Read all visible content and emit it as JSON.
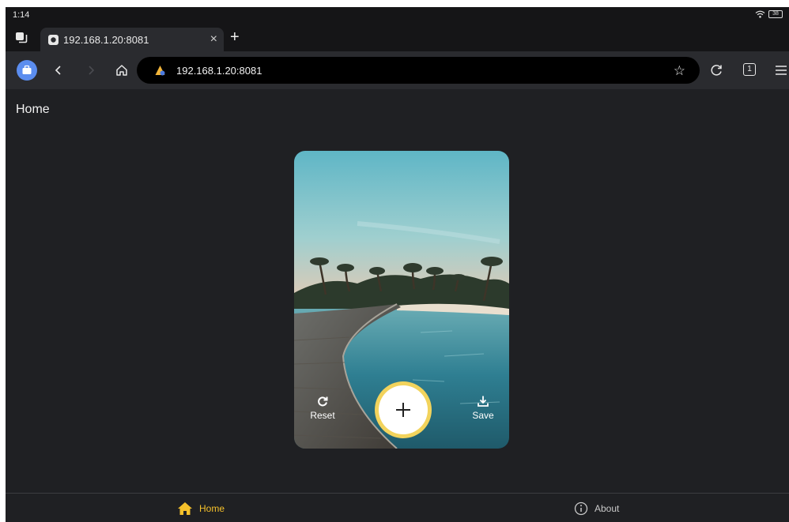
{
  "status_bar": {
    "time": "1:14",
    "battery": "38"
  },
  "browser": {
    "tab": {
      "title": "192.168.1.20:8081"
    },
    "address_bar": {
      "url": "192.168.1.20:8081"
    },
    "tab_count": "1"
  },
  "page": {
    "title": "Home"
  },
  "card": {
    "reset_label": "Reset",
    "save_label": "Save"
  },
  "bottom_nav": {
    "items": [
      {
        "label": "Home",
        "active": true
      },
      {
        "label": "About",
        "active": false
      }
    ]
  },
  "colors": {
    "accent": "#f5c12b",
    "fab_ring": "#f2d35c",
    "background": "#1f2023",
    "toolbar": "#2a2b2f"
  }
}
